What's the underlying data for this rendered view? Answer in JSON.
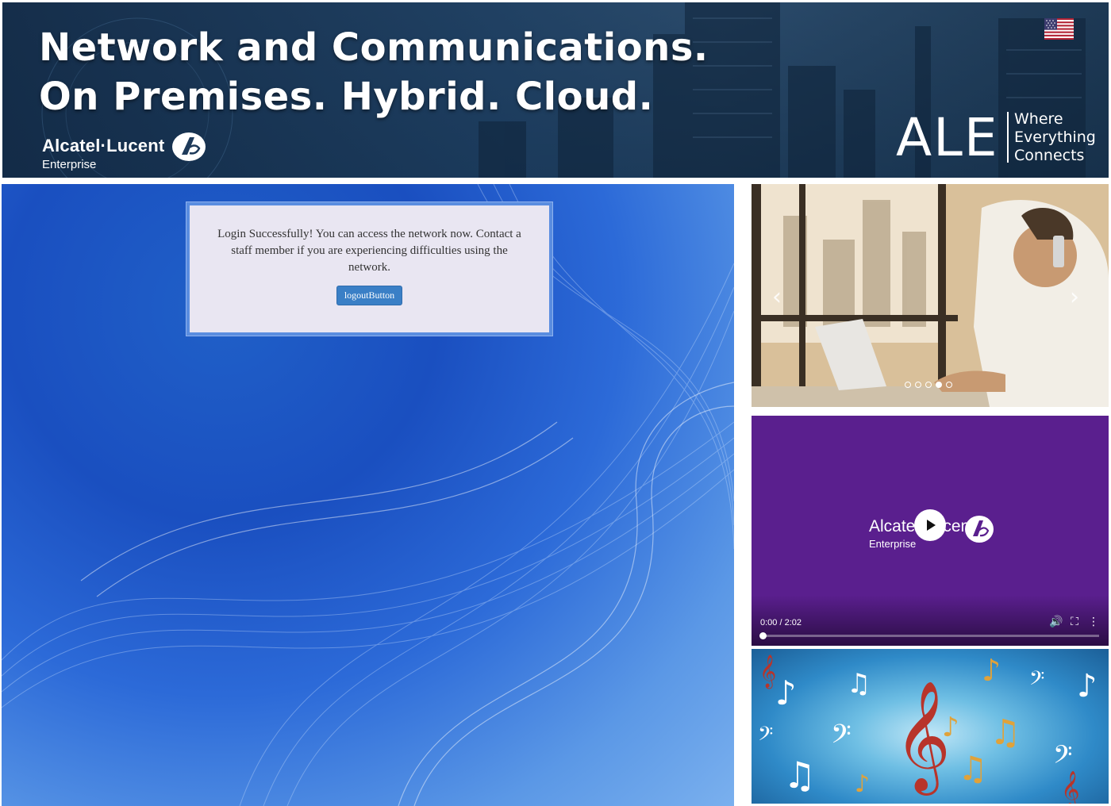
{
  "banner": {
    "title_line1": "Network and Communications.",
    "title_line2": "On Premises. Hybrid. Cloud.",
    "brand_name": "Alcatel·Lucent",
    "brand_sub": "Enterprise",
    "ale_mark": "ALE",
    "tagline": [
      "Where",
      "Everything",
      "Connects"
    ],
    "language_flag_icon": "us-flag-icon"
  },
  "portal": {
    "message": "Login Successfully! You can access the network now. Contact a staff member if you are experiencing difficulties using the network.",
    "logout_label": "logoutButton"
  },
  "carousel": {
    "prev_label": "‹",
    "next_label": "›",
    "slide_count": 5,
    "active_slide_index": 3
  },
  "video": {
    "brand_name": "Alcatel·Lucent",
    "brand_sub": "Enterprise",
    "time": "0:00 / 2:02",
    "progress_fraction": 0,
    "controls": [
      "volume-icon",
      "fullscreen-icon",
      "more-options-icon"
    ]
  },
  "colors": {
    "video_bg": "#5a1f8e",
    "button_bg": "#3a7fc6",
    "message_box_border": "#5a8de0"
  }
}
